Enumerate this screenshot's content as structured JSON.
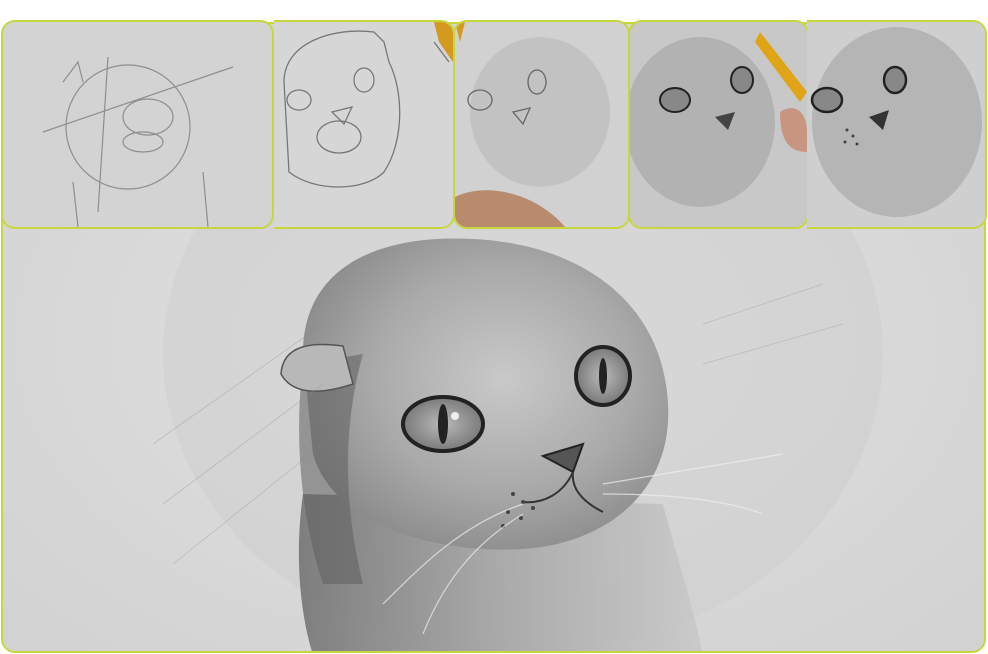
{
  "figure": {
    "description_type": "pencil-drawing-steps",
    "thumbnails": [
      {
        "step": "sketch-outline"
      },
      {
        "step": "features-outlined"
      },
      {
        "step": "first-shading"
      },
      {
        "step": "deeper-shading"
      },
      {
        "step": "final-thumbnail"
      }
    ],
    "main": {
      "step": "final-drawing"
    }
  },
  "colors": {
    "border": "#c7d63b",
    "paper": "#dcdcdc",
    "pencil": "#f0b400"
  }
}
